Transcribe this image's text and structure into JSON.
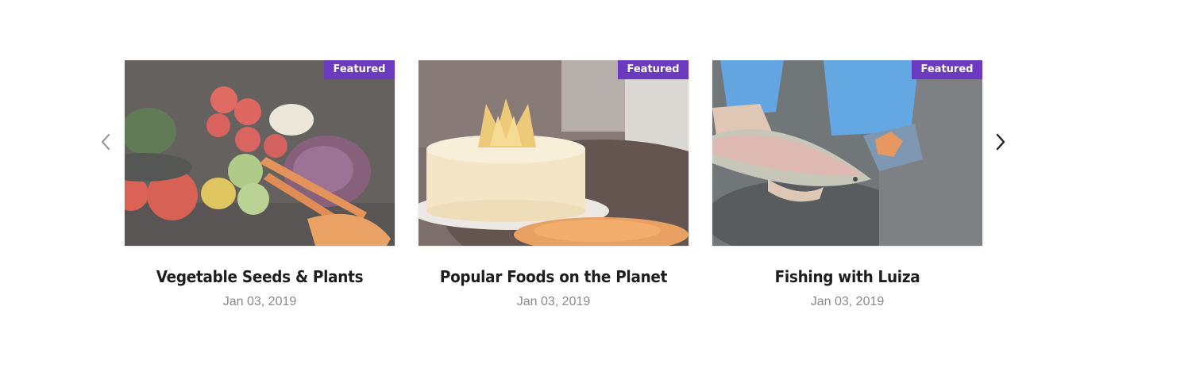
{
  "carousel": {
    "prev_icon": "chevron-left-icon",
    "next_icon": "chevron-right-icon",
    "arrow_colors": {
      "prev": "#9a9a9a",
      "next": "#222222"
    },
    "badge_color": "#6a3bbf",
    "cards": [
      {
        "badge": "Featured",
        "title": "Vegetable Seeds & Plants",
        "date": "Jan 03, 2019",
        "image": "vegetables-image"
      },
      {
        "badge": "Featured",
        "title": "Popular Foods on the Planet",
        "date": "Jan 03, 2019",
        "image": "cake-image"
      },
      {
        "badge": "Featured",
        "title": "Fishing with Luiza",
        "date": "Jan 03, 2019",
        "image": "fishing-image"
      }
    ]
  }
}
